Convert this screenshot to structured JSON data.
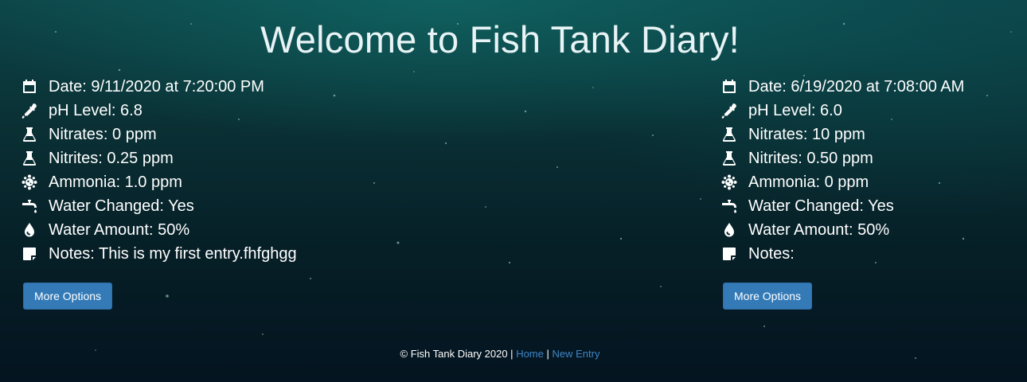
{
  "page": {
    "title": "Welcome to Fish Tank Diary!"
  },
  "entries": [
    {
      "date": "Date: 9/11/2020 at 7:20:00 PM",
      "ph": "pH Level: 6.8",
      "nitrates": "Nitrates: 0 ppm",
      "nitrites": "Nitrites: 0.25 ppm",
      "ammonia": "Ammonia: 1.0 ppm",
      "water_changed": "Water Changed: Yes",
      "water_amount": "Water Amount: 50%",
      "notes": "Notes: This is my first entry.fhfghgg",
      "button_label": "More Options"
    },
    {
      "date": "Date: 6/19/2020 at 7:08:00 AM",
      "ph": "pH Level: 6.0",
      "nitrates": "Nitrates: 10 ppm",
      "nitrites": "Nitrites: 0.50 ppm",
      "ammonia": "Ammonia: 0 ppm",
      "water_changed": "Water Changed: Yes",
      "water_amount": "Water Amount: 50%",
      "notes": "Notes:",
      "button_label": "More Options"
    }
  ],
  "footer": {
    "copyright": "© Fish Tank Diary 2020 |",
    "home_link": "Home",
    "separator": "|",
    "new_entry_link": "New Entry"
  },
  "icons": {
    "date": "calendar-icon",
    "ph": "eyedropper-icon",
    "nitrates": "flask-icon",
    "nitrites": "flask-icon",
    "ammonia": "virus-icon",
    "water_changed": "faucet-icon",
    "water_amount": "water-drop-icon",
    "notes": "sticky-note-icon"
  },
  "colors": {
    "button": "#337ab7",
    "link": "#3f86c8",
    "text": "#ffffff"
  }
}
